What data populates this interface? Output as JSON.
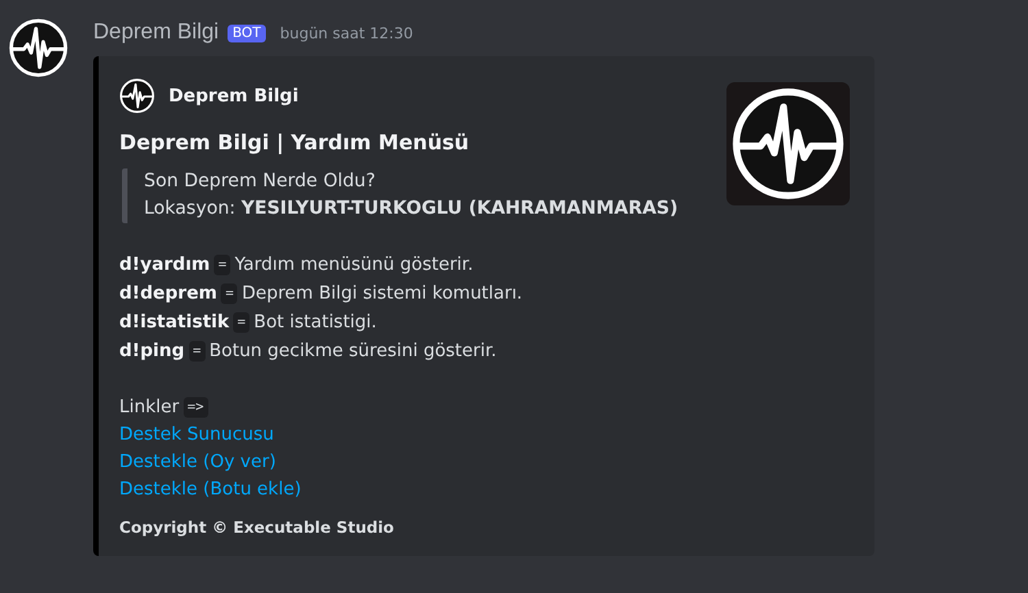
{
  "message": {
    "author": "Deprem Bilgi",
    "badge": "BOT",
    "timestamp": "bugün saat 12:30"
  },
  "embed": {
    "author": "Deprem Bilgi",
    "title": "Deprem Bilgi | Yardım Menüsü",
    "quote": [
      "Son Deprem Nerde Oldu?",
      "Lokasyon: **YESILYURT-TURKOGLU (KAHRAMANMARAS)**"
    ],
    "commands": [
      {
        "command": "d!yardım",
        "separator": "=",
        "description": "Yardım menüsünü gösterir."
      },
      {
        "command": "d!deprem",
        "separator": "=",
        "description": "Deprem Bilgi sistemi komutları."
      },
      {
        "command": "d!istatistik",
        "separator": "=",
        "description": "Bot istatistigi."
      },
      {
        "command": "d!ping",
        "separator": "=",
        "description": "Botun gecikme süresini gösterir."
      }
    ],
    "links_label": "Linkler",
    "links_code": "=>",
    "links": [
      "Destek Sunucusu",
      "Destekle (Oy ver)",
      "Destekle (Botu ekle)"
    ],
    "footer": "Copyright © Executable Studio"
  }
}
